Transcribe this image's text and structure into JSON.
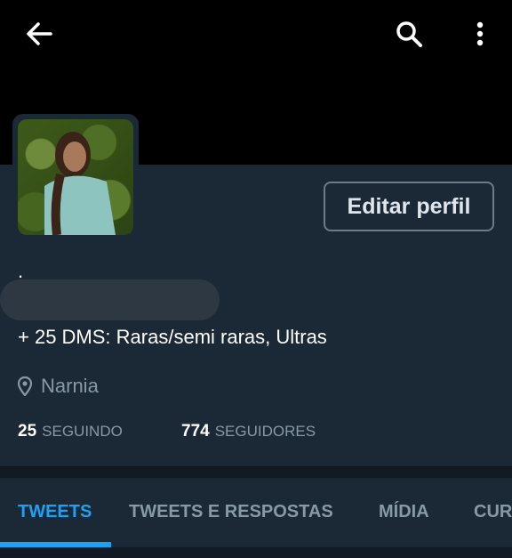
{
  "header": {
    "icons": [
      "arrow-left-icon",
      "search-icon",
      "more-vertical-icon"
    ]
  },
  "profile": {
    "edit_label": "Editar perfil",
    "name_partial": ".",
    "bio": "+ 25 DMS: Raras/semi raras, Ultras",
    "location": "Narnia",
    "following_count": "25",
    "following_label": "SEGUINDO",
    "followers_count": "774",
    "followers_label": "SEGUIDORES"
  },
  "tabs": [
    {
      "label": "TWEETS",
      "active": true
    },
    {
      "label": "TWEETS E RESPOSTAS",
      "active": false
    },
    {
      "label": "MÍDIA",
      "active": false
    },
    {
      "label": "CUR",
      "active": false
    }
  ],
  "colors": {
    "accent": "#1da1f2",
    "background": "#1b2836",
    "muted": "#8899a6"
  }
}
